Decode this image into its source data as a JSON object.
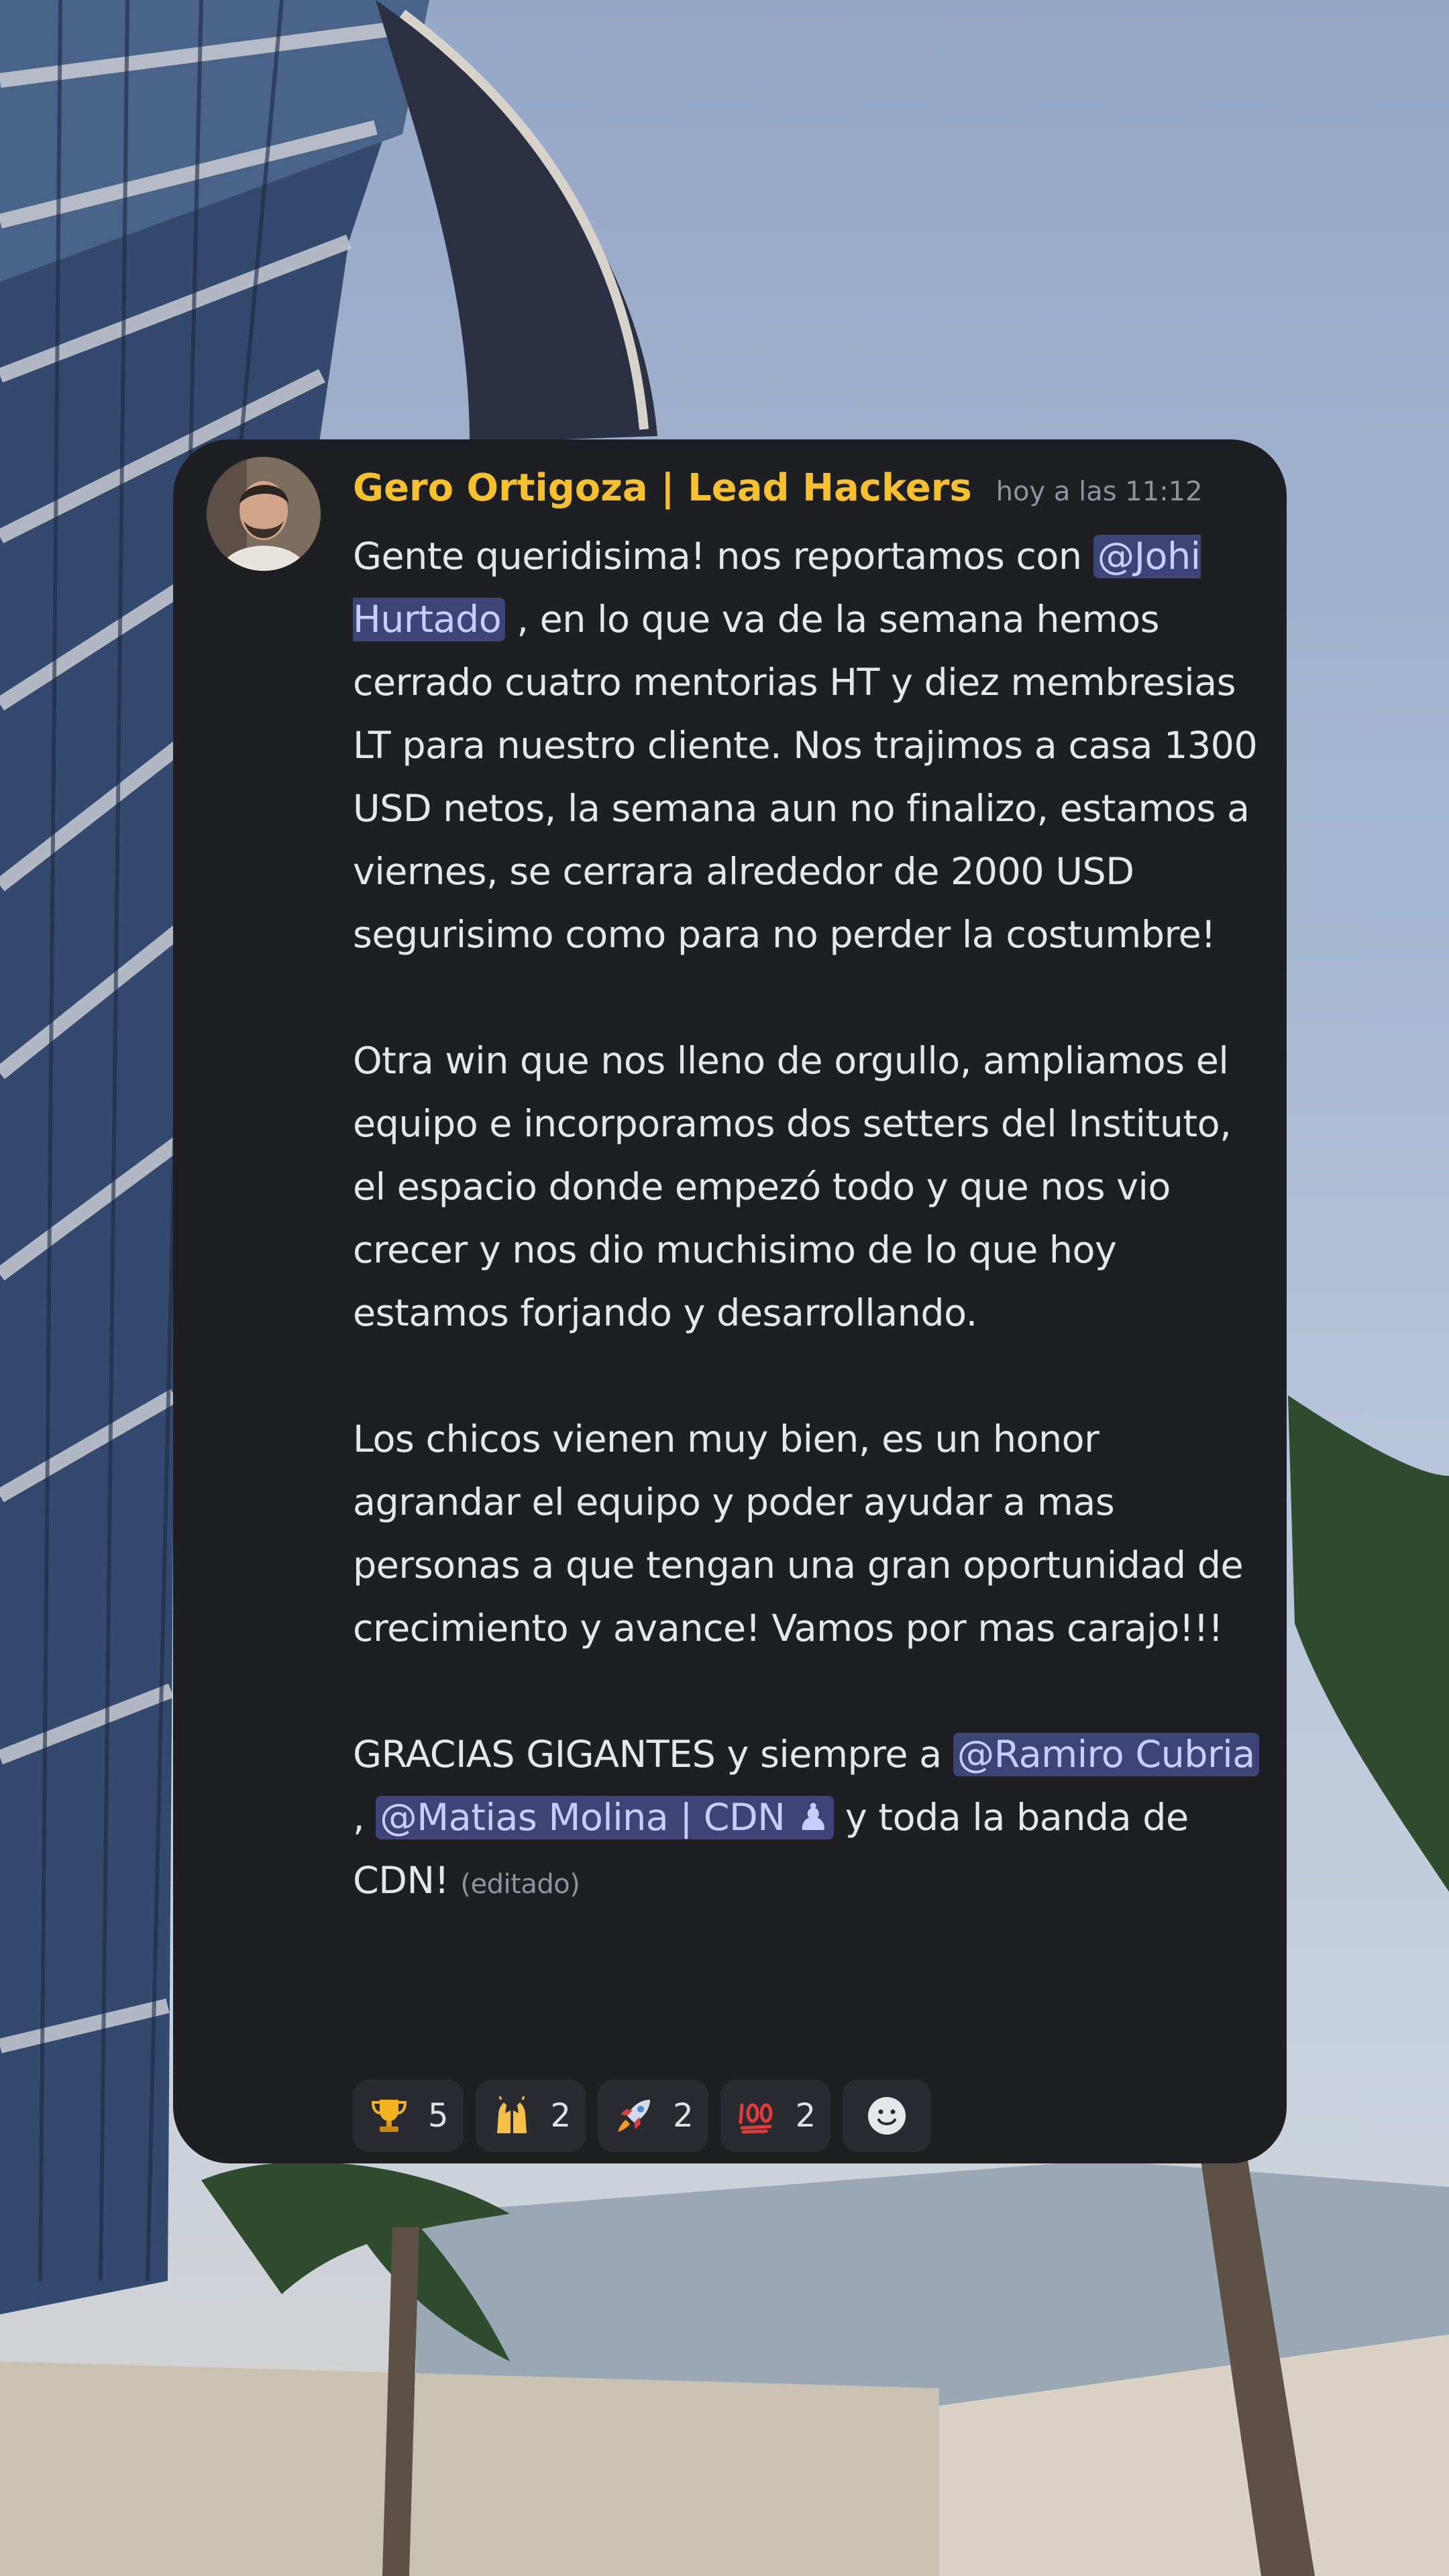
{
  "message": {
    "author": "Gero Ortigoza | Lead Hackers",
    "timestamp": "hoy a las 11:12",
    "p1": {
      "t1": "Gente queridisima! nos reportamos con ",
      "m1": "@Johi Hurtado",
      "t2": " , en lo que va de la semana hemos cerrado cuatro mentorias HT y diez membresias LT para nuestro cliente. Nos trajimos a casa 1300 USD netos, la semana aun no finalizo, estamos a viernes, se cerrara alrededor de 2000 USD segurisimo como para no perder la costumbre!"
    },
    "p2": "Otra win que nos lleno de orgullo, ampliamos el equipo e incorporamos dos setters del Instituto, el espacio donde empezó todo y que nos vio crecer y nos dio muchisimo de lo que hoy estamos forjando y desarrollando.",
    "p3": "Los chicos vienen muy bien, es un honor agrandar el equipo y poder ayudar a mas personas a que tengan una gran oportunidad de crecimiento y avance! Vamos por mas carajo!!!",
    "p4": {
      "t1": "GRACIAS GIGANTES y siempre a ",
      "m1": "@Ramiro Cubria",
      "t2": " , ",
      "m2": "@Matias Molina | CDN ♟",
      "t3": " y toda la banda de CDN!",
      "edited": "(editado)"
    }
  },
  "reactions": [
    {
      "emoji": "trophy-icon",
      "count": "5"
    },
    {
      "emoji": "raised-hands-icon",
      "count": "2"
    },
    {
      "emoji": "rocket-icon",
      "count": "2"
    },
    {
      "emoji": "hundred-points-icon",
      "count": "2"
    }
  ],
  "colors": {
    "card_bg": "#1e1f23",
    "username": "#f6c12d",
    "mention_bg": "#3e4478",
    "mention_text": "#c9ceff",
    "reaction_bg": "#2a2b31"
  }
}
